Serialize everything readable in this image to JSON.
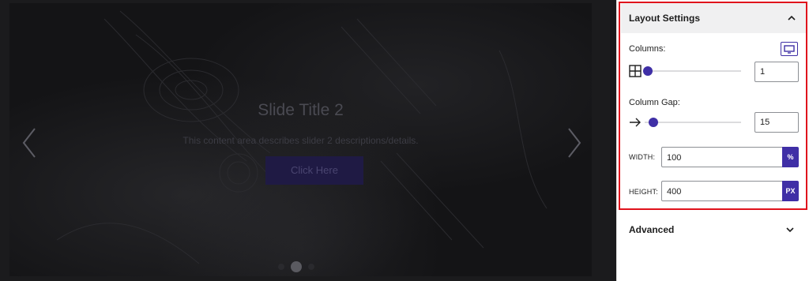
{
  "slider": {
    "title": "Slide Title 2",
    "description": "This content area describes slider 2 descriptions/details.",
    "button_label": "Click Here",
    "dots_count": 3,
    "active_dot": 2
  },
  "panel": {
    "layout_settings": {
      "title": "Layout Settings",
      "expanded": true,
      "columns": {
        "label": "Columns:",
        "value": "1",
        "slider_fraction": 0.0
      },
      "column_gap": {
        "label": "Column Gap:",
        "value": "15",
        "slider_fraction": 0.05
      },
      "width": {
        "label": "WIDTH:",
        "value": "100",
        "unit": "%"
      },
      "height": {
        "label": "HEIGHT:",
        "value": "400",
        "unit": "PX"
      }
    },
    "advanced": {
      "title": "Advanced",
      "expanded": false
    }
  },
  "colors": {
    "accent": "#3f2fa6",
    "highlight_border": "#e0121c",
    "header_bg": "#f0f0f1"
  },
  "icons": [
    "chevron-left-icon",
    "chevron-right-icon",
    "chevron-up-icon",
    "chevron-down-icon",
    "desktop-icon",
    "grid-icon",
    "arrow-right-icon"
  ]
}
